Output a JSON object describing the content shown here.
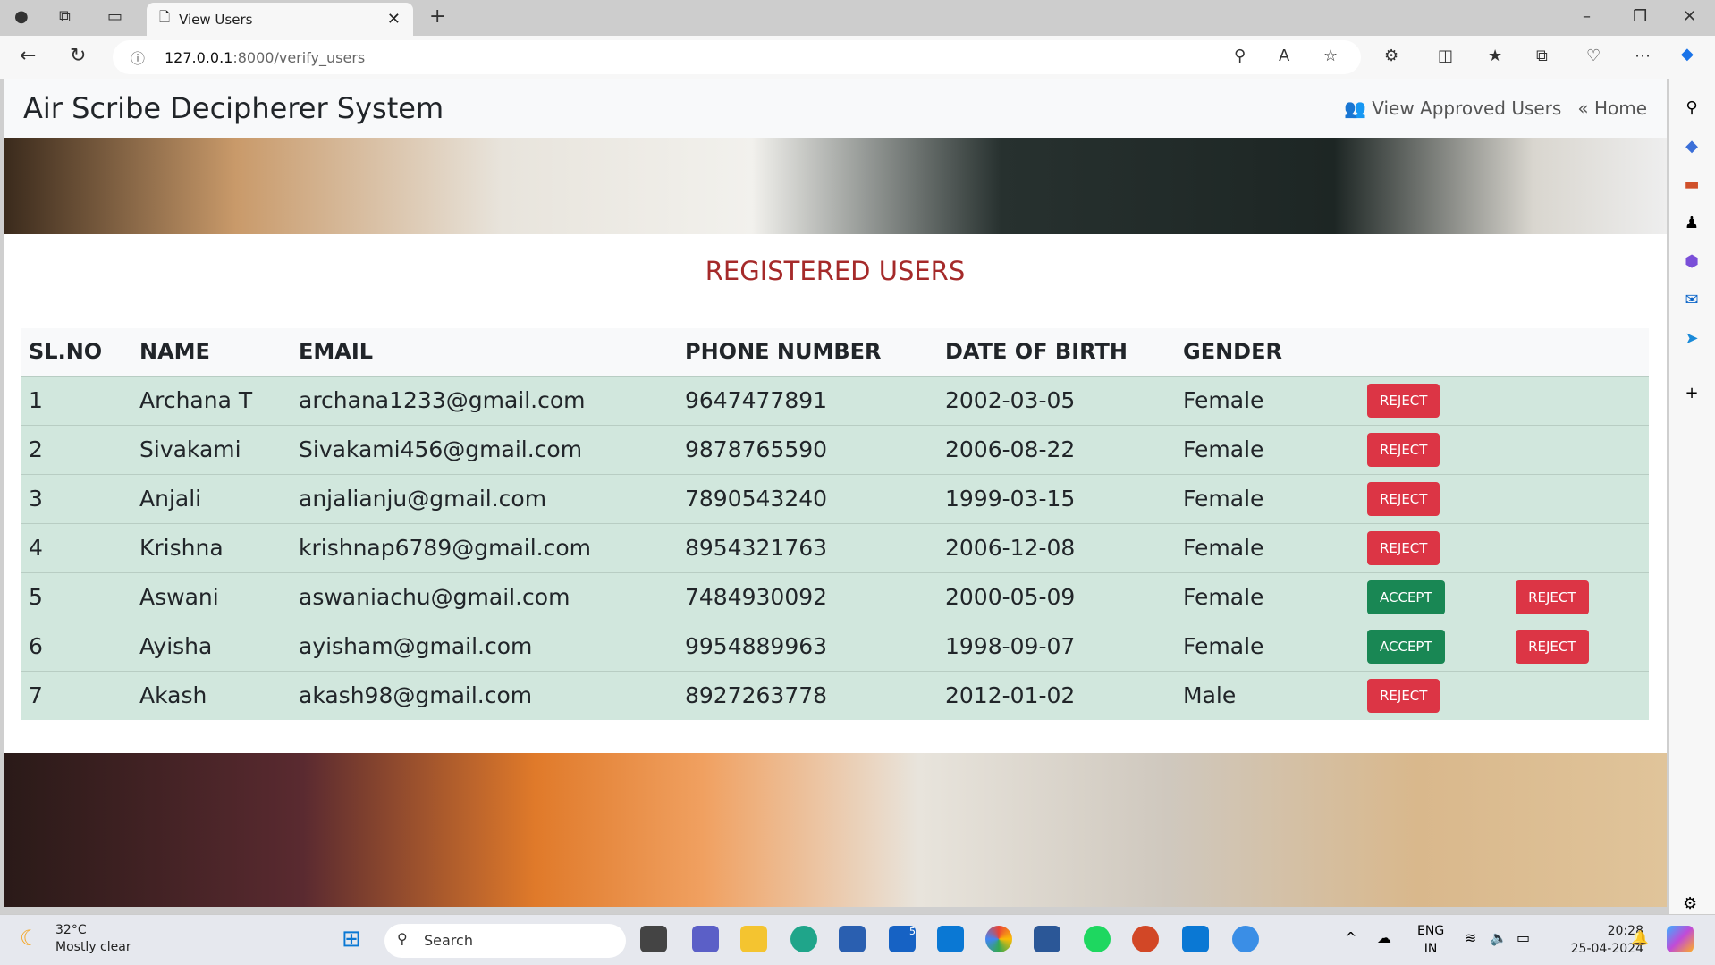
{
  "browser": {
    "tab_title": "View Users",
    "url_host": "127.0.0.1",
    "url_rest": ":8000/verify_users"
  },
  "nav": {
    "brand": "Air Scribe Decipherer System",
    "links": [
      {
        "label": "View Approved Users",
        "icon": "users-icon"
      },
      {
        "label": "Home",
        "icon": "double-chevron-left-icon"
      }
    ]
  },
  "title": "REGISTERED USERS",
  "table": {
    "headers": [
      "SL.NO",
      "NAME",
      "EMAIL",
      "PHONE NUMBER",
      "DATE OF BIRTH",
      "GENDER"
    ],
    "rows": [
      {
        "sl": "1",
        "name": "Archana T",
        "email": "archana1233@gmail.com",
        "phone": "9647477891",
        "dob": "2002-03-05",
        "gender": "Female",
        "actions": [
          "REJECT"
        ]
      },
      {
        "sl": "2",
        "name": "Sivakami",
        "email": "Sivakami456@gmail.com",
        "phone": "9878765590",
        "dob": "2006-08-22",
        "gender": "Female",
        "actions": [
          "REJECT"
        ]
      },
      {
        "sl": "3",
        "name": "Anjali",
        "email": "anjalianju@gmail.com",
        "phone": "7890543240",
        "dob": "1999-03-15",
        "gender": "Female",
        "actions": [
          "REJECT"
        ]
      },
      {
        "sl": "4",
        "name": "Krishna",
        "email": "krishnap6789@gmail.com",
        "phone": "8954321763",
        "dob": "2006-12-08",
        "gender": "Female",
        "actions": [
          "REJECT"
        ]
      },
      {
        "sl": "5",
        "name": "Aswani",
        "email": "aswaniachu@gmail.com",
        "phone": "7484930092",
        "dob": "2000-05-09",
        "gender": "Female",
        "actions": [
          "ACCEPT",
          "REJECT"
        ]
      },
      {
        "sl": "6",
        "name": "Ayisha",
        "email": "ayisham@gmail.com",
        "phone": "9954889963",
        "dob": "1998-09-07",
        "gender": "Female",
        "actions": [
          "ACCEPT",
          "REJECT"
        ]
      },
      {
        "sl": "7",
        "name": "Akash",
        "email": "akash98@gmail.com",
        "phone": "8927263778",
        "dob": "2012-01-02",
        "gender": "Male",
        "actions": [
          "REJECT"
        ]
      }
    ]
  },
  "colors": {
    "reject": "#dc3545",
    "accept": "#198754",
    "title": "#a52a2a",
    "row": "#d1e7dd"
  },
  "taskbar": {
    "temp": "32°C",
    "weather": "Mostly clear",
    "search": "Search",
    "lang1": "ENG",
    "lang2": "IN",
    "time": "20:28",
    "date": "25-04-2024",
    "badge": "5"
  }
}
